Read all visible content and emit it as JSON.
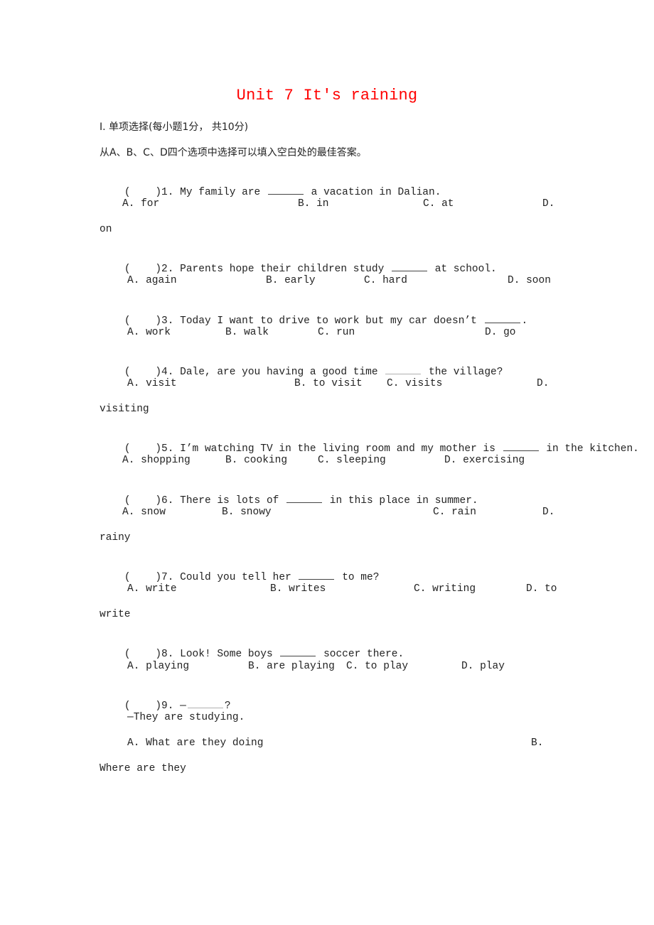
{
  "document": {
    "title": "Unit 7 It's raining",
    "title_color": "#ff0000",
    "section_heading": "I. 单项选择(每小题1分， 共10分)",
    "instruction": "从A、B、C、D四个选项中选择可以填入空白处的最佳答案。"
  },
  "questions": [
    {
      "number": "1.",
      "paren": "(    )",
      "stem_before": "My family are",
      "stem_after": "a vacation in Dalian.",
      "options": {
        "A": "A. for",
        "B": "B. in",
        "C": "C. at",
        "D": "D.",
        "D_wrap": "on"
      }
    },
    {
      "number": "2.",
      "paren": "(    )",
      "stem_before": "Parents hope their children study",
      "stem_after": "at school.",
      "options": {
        "A": "A. again",
        "B": "B. early",
        "C": "C. hard",
        "D": "D. soon"
      }
    },
    {
      "number": "3.",
      "paren": "(    )",
      "stem_before": "Today I want to drive to work but my car doesn’t",
      "stem_after": ".",
      "options": {
        "A": "A. work",
        "B": "B. walk",
        "C": "C. run",
        "D": "D. go"
      }
    },
    {
      "number": "4.",
      "paren": "(    )",
      "stem_before": "Dale, are you having a good time",
      "stem_after": "the village?",
      "options": {
        "A": "A. visit",
        "B": "B. to visit",
        "C": "C. visits",
        "D": "D.",
        "D_wrap": "visiting"
      }
    },
    {
      "number": "5.",
      "paren": "(    )",
      "stem_before": "I’m watching TV in the living room and my mother is",
      "stem_after": "in the kitchen.",
      "options": {
        "A": "A. shopping",
        "B": "B. cooking",
        "C": "C. sleeping",
        "D": "D. exercising"
      }
    },
    {
      "number": "6.",
      "paren": "(    )",
      "stem_before": "There is lots of",
      "stem_after": "in this place in summer.",
      "options": {
        "A": "A. snow",
        "B": "B. snowy",
        "C": "C. rain",
        "D": "D.",
        "D_wrap": "rainy"
      }
    },
    {
      "number": "7.",
      "paren": "(    )",
      "stem_before": "Could you tell her",
      "stem_after": "to me?",
      "options": {
        "A": "A. write",
        "B": "B. writes",
        "C": "C. writing",
        "D": "D. to",
        "D_wrap": "write"
      }
    },
    {
      "number": "8.",
      "paren": "(    )",
      "stem_before": "Look! Some boys",
      "stem_after": "soccer there.",
      "options": {
        "A": "A. playing",
        "B": "B. are playing",
        "C": "C. to play",
        "D": "D. play"
      }
    },
    {
      "number": "9.",
      "paren": "(    )",
      "stem_before": "—",
      "stem_after": "?",
      "reply": "—They are studying.",
      "options": {
        "A": "A. What are they doing",
        "B": "B.",
        "B_wrap": "Where are they"
      }
    }
  ]
}
